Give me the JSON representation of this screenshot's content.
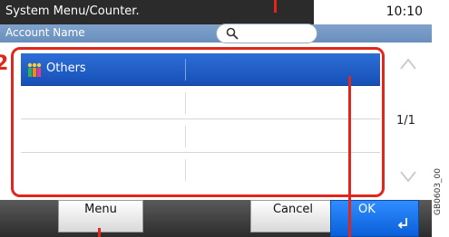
{
  "header": {
    "title": "System Menu/Counter.",
    "time": "10:10",
    "field_label": "Account Name"
  },
  "search": {
    "icon": "search-icon"
  },
  "list": {
    "rows": [
      {
        "name": "Others",
        "selected": true,
        "icon": "group-icon"
      },
      {
        "name": ""
      },
      {
        "name": ""
      },
      {
        "name": ""
      }
    ]
  },
  "pager": {
    "indicator": "1/1",
    "up_icon": "chevron-up-icon",
    "down_icon": "chevron-down-icon"
  },
  "buttons": {
    "menu_label": "Menu",
    "cancel_label": "Cancel",
    "ok_label": "OK",
    "ok_icon": "enter-arrow-icon"
  },
  "annotations": {
    "step_number": "2",
    "figure_code": "GB0603_00",
    "color": "#e1261c"
  }
}
